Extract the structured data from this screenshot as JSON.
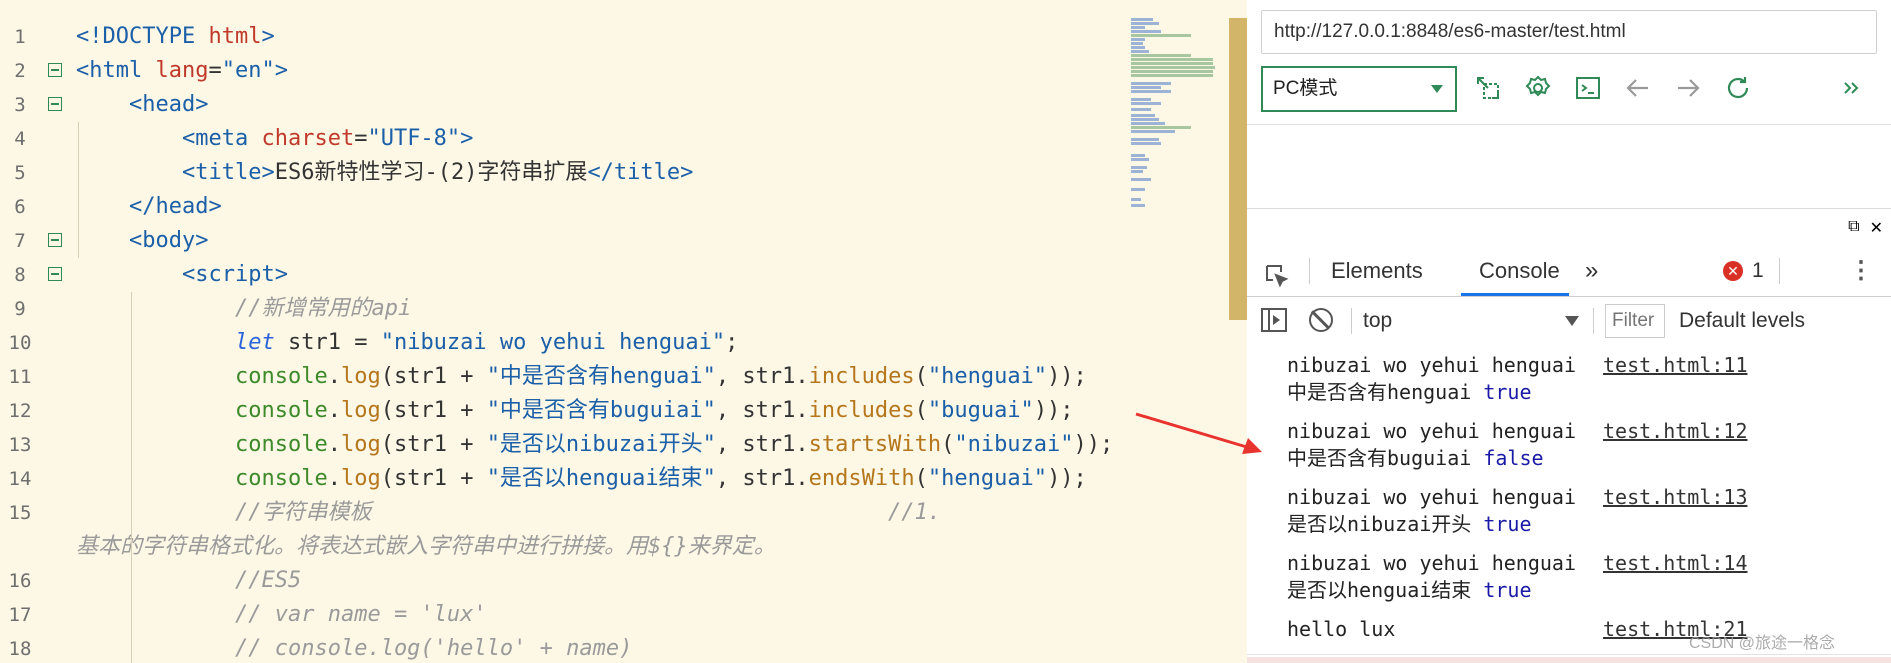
{
  "editor": {
    "lines": [
      {
        "n": "1",
        "fold": false,
        "indent": 0,
        "tokens": [
          [
            "t-tag",
            "<!DOCTYPE "
          ],
          [
            "t-attr",
            "html"
          ],
          [
            "t-tag",
            ">"
          ]
        ]
      },
      {
        "n": "2",
        "fold": true,
        "indent": 0,
        "tokens": [
          [
            "t-tag",
            "<html "
          ],
          [
            "t-attr",
            "lang"
          ],
          [
            "t-op",
            "="
          ],
          [
            "t-str",
            "\"en\""
          ],
          [
            "t-tag",
            ">"
          ]
        ]
      },
      {
        "n": "3",
        "fold": true,
        "indent": 1,
        "tokens": [
          [
            "t-tag",
            "<head>"
          ]
        ]
      },
      {
        "n": "4",
        "fold": false,
        "indent": 2,
        "tokens": [
          [
            "t-tag",
            "<meta "
          ],
          [
            "t-attr",
            "charset"
          ],
          [
            "t-op",
            "="
          ],
          [
            "t-str",
            "\"UTF-8\""
          ],
          [
            "t-tag",
            ">"
          ]
        ]
      },
      {
        "n": "5",
        "fold": false,
        "indent": 2,
        "tokens": [
          [
            "t-tag",
            "<title>"
          ],
          [
            "t-txt",
            "ES6新特性学习-(2)字符串扩展"
          ],
          [
            "t-tag",
            "</title>"
          ]
        ]
      },
      {
        "n": "6",
        "fold": false,
        "indent": 1,
        "tokens": [
          [
            "t-tag",
            "</head>"
          ]
        ]
      },
      {
        "n": "7",
        "fold": true,
        "indent": 1,
        "tokens": [
          [
            "t-tag",
            "<body>"
          ]
        ]
      },
      {
        "n": "8",
        "fold": true,
        "indent": 2,
        "tokens": [
          [
            "t-tag",
            "<script>"
          ]
        ]
      },
      {
        "n": "9",
        "fold": false,
        "indent": 3,
        "tokens": [
          [
            "t-cmt",
            "//新增常用的api"
          ]
        ]
      },
      {
        "n": "10",
        "fold": false,
        "indent": 3,
        "tokens": [
          [
            "t-kw",
            "let "
          ],
          [
            "t-txt",
            "str1 = "
          ],
          [
            "t-str",
            "\"nibuzai wo yehui henguai\""
          ],
          [
            "t-txt",
            ";"
          ]
        ]
      },
      {
        "n": "11",
        "fold": false,
        "indent": 3,
        "tokens": [
          [
            "t-fn",
            "console"
          ],
          [
            "t-txt",
            "."
          ],
          [
            "t-m",
            "log"
          ],
          [
            "t-txt",
            "(str1 + "
          ],
          [
            "t-str",
            "\"中是否含有henguai\""
          ],
          [
            "t-txt",
            ", str1."
          ],
          [
            "t-m",
            "includes"
          ],
          [
            "t-txt",
            "("
          ],
          [
            "t-str",
            "\"henguai\""
          ],
          [
            "t-txt",
            "));"
          ]
        ]
      },
      {
        "n": "12",
        "fold": false,
        "indent": 3,
        "tokens": [
          [
            "t-fn",
            "console"
          ],
          [
            "t-txt",
            "."
          ],
          [
            "t-m",
            "log"
          ],
          [
            "t-txt",
            "(str1 + "
          ],
          [
            "t-str",
            "\"中是否含有buguiai\""
          ],
          [
            "t-txt",
            ", str1."
          ],
          [
            "t-m",
            "includes"
          ],
          [
            "t-txt",
            "("
          ],
          [
            "t-str",
            "\"buguai\""
          ],
          [
            "t-txt",
            "));"
          ]
        ]
      },
      {
        "n": "13",
        "fold": false,
        "indent": 3,
        "tokens": [
          [
            "t-fn",
            "console"
          ],
          [
            "t-txt",
            "."
          ],
          [
            "t-m",
            "log"
          ],
          [
            "t-txt",
            "(str1 + "
          ],
          [
            "t-str",
            "\"是否以nibuzai开头\""
          ],
          [
            "t-txt",
            ", str1."
          ],
          [
            "t-m",
            "startsWith"
          ],
          [
            "t-txt",
            "("
          ],
          [
            "t-str",
            "\"nibuzai\""
          ],
          [
            "t-txt",
            "));"
          ]
        ]
      },
      {
        "n": "14",
        "fold": false,
        "indent": 3,
        "tokens": [
          [
            "t-fn",
            "console"
          ],
          [
            "t-txt",
            "."
          ],
          [
            "t-m",
            "log"
          ],
          [
            "t-txt",
            "(str1 + "
          ],
          [
            "t-str",
            "\"是否以henguai结束\""
          ],
          [
            "t-txt",
            ", str1."
          ],
          [
            "t-m",
            "endsWith"
          ],
          [
            "t-txt",
            "("
          ],
          [
            "t-str",
            "\"henguai\""
          ],
          [
            "t-txt",
            "));"
          ]
        ]
      },
      {
        "n": "15",
        "fold": false,
        "indent": 3,
        "tokens": [
          [
            "t-cmt",
            "//字符串模板                                       //1."
          ]
        ],
        "wrap": [
          [
            "t-cmt",
            "基本的字符串格式化。将表达式嵌入字符串中进行拼接。用${}来界定。"
          ]
        ]
      },
      {
        "n": "16",
        "fold": false,
        "indent": 3,
        "tokens": [
          [
            "t-cmt",
            "//ES5"
          ]
        ]
      },
      {
        "n": "17",
        "fold": false,
        "indent": 3,
        "tokens": [
          [
            "t-cmt",
            "// var name = 'lux'"
          ]
        ]
      },
      {
        "n": "18",
        "fold": false,
        "indent": 3,
        "tokens": [
          [
            "t-cmt",
            "// console.log('hello' + name)"
          ]
        ]
      }
    ]
  },
  "browser": {
    "url": "http://127.0.0.1:8848/es6-master/test.html",
    "mode": "PC模式",
    "toolbar_icons": [
      "screenshot-icon",
      "settings-icon",
      "terminal-icon",
      "back-icon",
      "forward-icon",
      "reload-icon",
      "more-icon"
    ],
    "accent": "#2f8a57"
  },
  "devtools": {
    "tabs": {
      "elements": "Elements",
      "console": "Console",
      "more": "»"
    },
    "error_count": "1",
    "context": "top",
    "filter_placeholder": "Filter",
    "levels": "Default levels",
    "messages": [
      {
        "text": "nibuzai wo yehui henguai中是否含有henguai",
        "value": "true",
        "source": "test.html:11"
      },
      {
        "text": "nibuzai wo yehui henguai中是否含有buguiai",
        "value": "false",
        "source": "test.html:12"
      },
      {
        "text": "nibuzai wo yehui henguai是否以nibuzai开头",
        "value": "true",
        "source": "test.html:13"
      },
      {
        "text": "nibuzai wo yehui henguai是否以henguai结束",
        "value": "true",
        "source": "test.html:14"
      },
      {
        "text": "hello lux",
        "value": "",
        "source": "test.html:21"
      }
    ],
    "watermark": "CSDN @旅途一格念"
  }
}
